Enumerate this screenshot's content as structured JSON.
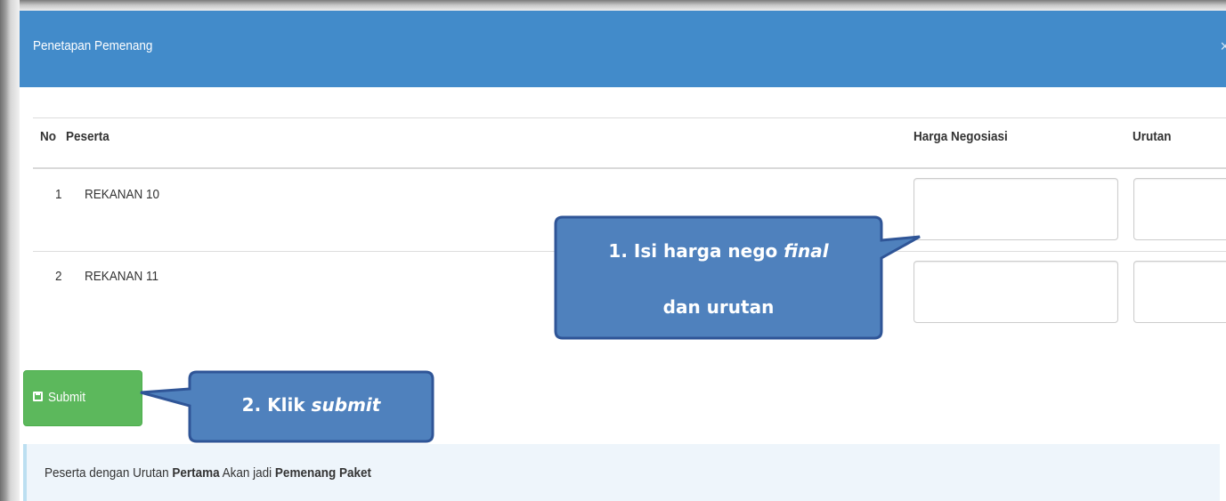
{
  "modal": {
    "title": "Penetapan Pemenang",
    "close_icon": "×",
    "header_color": "#428bca"
  },
  "table": {
    "headers": {
      "no": "No",
      "peserta": "Peserta",
      "harga": "Harga Negosiasi",
      "urutan": "Urutan"
    },
    "rows": [
      {
        "no": "1",
        "peserta": "REKANAN 10",
        "harga": "",
        "urutan": ""
      },
      {
        "no": "2",
        "peserta": "REKANAN 11",
        "harga": "",
        "urutan": ""
      }
    ]
  },
  "submit": {
    "label": "Submit",
    "icon": "floppy-icon",
    "color": "#5cb85c"
  },
  "info": {
    "text_1": "Peserta dengan Urutan ",
    "bold_1": "Pertama",
    "text_2": " Akan jadi ",
    "bold_2": "Pemenang Paket"
  },
  "callouts": {
    "first_line1_a": "1. Isi harga nego ",
    "first_line1_b": "final",
    "first_line2": "dan urutan",
    "second_a": "2. Klik ",
    "second_b": "submit",
    "fill_color": "#4f81bd",
    "border_color": "#2f5597"
  }
}
